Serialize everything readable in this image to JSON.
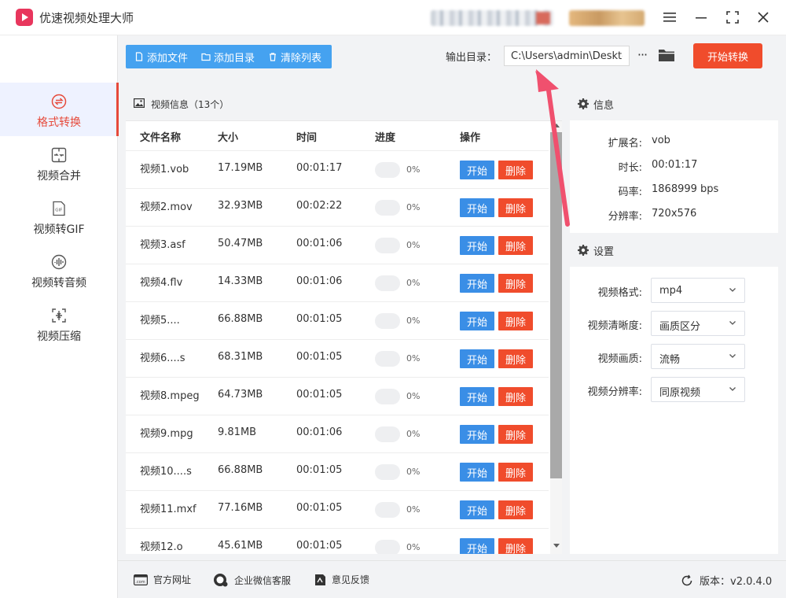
{
  "app": {
    "title": "优速视频处理大师"
  },
  "sidebar": {
    "items": [
      {
        "label": "格式转换",
        "icon": "swap-circle-icon",
        "active": true
      },
      {
        "label": "视频合并",
        "icon": "merge-icon",
        "active": false
      },
      {
        "label": "视频转GIF",
        "icon": "gif-icon",
        "active": false
      },
      {
        "label": "视频转音频",
        "icon": "audio-icon",
        "active": false
      },
      {
        "label": "视频压缩",
        "icon": "compress-icon",
        "active": false
      }
    ]
  },
  "toolbar": {
    "add_file": "添加文件",
    "add_dir": "添加目录",
    "clear_list": "清除列表",
    "output_label": "输出目录：",
    "output_path": "C:\\Users\\admin\\Desktop",
    "more": "···",
    "start_all": "开始转换"
  },
  "list": {
    "header": "视频信息（13个）",
    "columns": [
      "文件名称",
      "大小",
      "时间",
      "进度",
      "操作"
    ],
    "start_label": "开始",
    "delete_label": "删除",
    "rows": [
      {
        "name": "视频1.vob",
        "size": "17.19MB",
        "time": "00:01:17",
        "progress": "0%"
      },
      {
        "name": "视频2.mov",
        "size": "32.93MB",
        "time": "00:02:22",
        "progress": "0%"
      },
      {
        "name": "视频3.asf",
        "size": "50.47MB",
        "time": "00:01:06",
        "progress": "0%"
      },
      {
        "name": "视频4.flv",
        "size": "14.33MB",
        "time": "00:01:06",
        "progress": "0%"
      },
      {
        "name": "视频5....",
        "size": "66.88MB",
        "time": "00:01:05",
        "progress": "0%"
      },
      {
        "name": "视频6....s",
        "size": "68.31MB",
        "time": "00:01:05",
        "progress": "0%"
      },
      {
        "name": "视频8.mpeg",
        "size": "64.73MB",
        "time": "00:01:05",
        "progress": "0%"
      },
      {
        "name": "视频9.mpg",
        "size": "9.81MB",
        "time": "00:01:06",
        "progress": "0%"
      },
      {
        "name": "视频10....s",
        "size": "66.88MB",
        "time": "00:01:05",
        "progress": "0%"
      },
      {
        "name": "视频11.mxf",
        "size": "77.16MB",
        "time": "00:01:05",
        "progress": "0%"
      },
      {
        "name": "视频12.o",
        "size": "45.61MB",
        "time": "00:01:05",
        "progress": "0%"
      }
    ]
  },
  "info": {
    "title": "信息",
    "ext_label": "扩展名:",
    "ext": "vob",
    "dur_label": "时长:",
    "dur": "00:01:17",
    "rate_label": "码率:",
    "rate": "1868999 bps",
    "res_label": "分辨率:",
    "res": "720x576"
  },
  "settings": {
    "title": "设置",
    "format_label": "视频格式:",
    "format": "mp4",
    "clarity_label": "视频清晰度:",
    "clarity": "画质区分",
    "quality_label": "视频画质:",
    "quality": "流畅",
    "resolution_label": "视频分辨率:",
    "resolution": "同原视频"
  },
  "footer": {
    "website": "官方网址",
    "wechat": "企业微信客服",
    "feedback": "意见反馈",
    "version": "版本：v2.0.4.0"
  },
  "colors": {
    "accent_blue": "#3a8ee6",
    "toolbar_blue": "#45a2f0",
    "accent_red": "#f04c2c",
    "nav_active": "#e64a3b"
  }
}
